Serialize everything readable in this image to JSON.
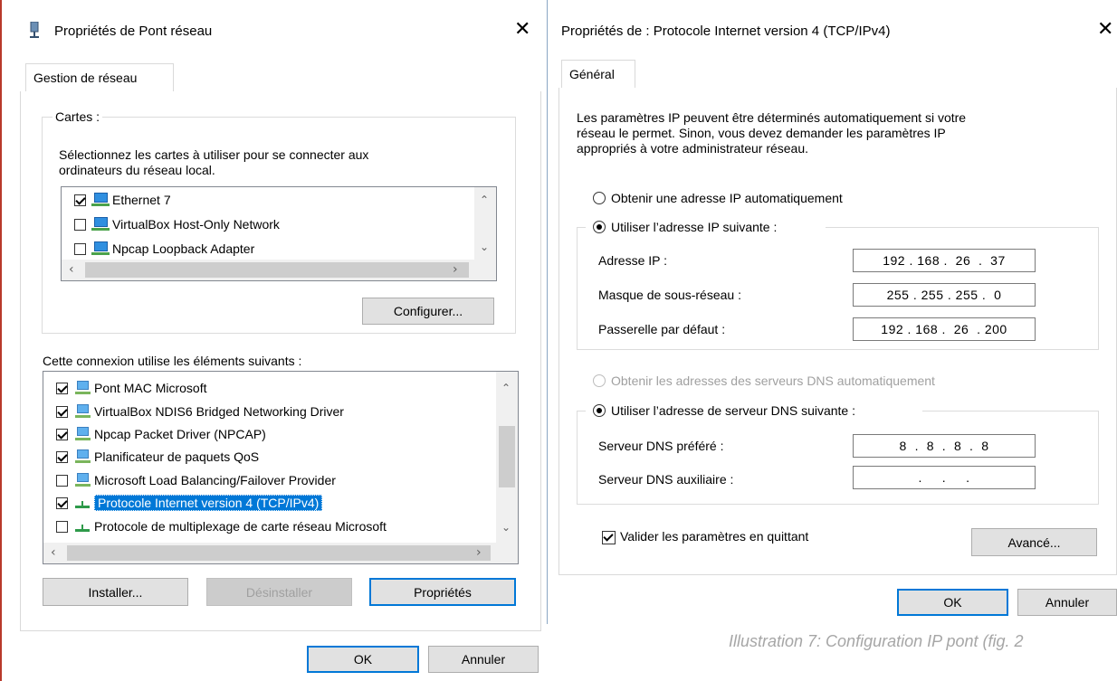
{
  "bridge": {
    "title": "Propriétés de Pont réseau",
    "tab": "Gestion de réseau",
    "cartes_label": "Cartes :",
    "cartes_desc": [
      "Sélectionnez les cartes à utiliser pour se connecter aux",
      "ordinateurs du réseau local."
    ],
    "adapters": [
      {
        "label": "Ethernet 7",
        "checked": true
      },
      {
        "label": "VirtualBox Host-Only Network",
        "checked": false
      },
      {
        "label": "Npcap Loopback Adapter",
        "checked": false
      }
    ],
    "configure_button": "Configurer...",
    "elements_label": "Cette connexion utilise les éléments suivants :",
    "components": [
      {
        "label": "Pont MAC Microsoft",
        "checked": true,
        "icon": "network-component-icon"
      },
      {
        "label": "VirtualBox NDIS6 Bridged Networking Driver",
        "checked": true,
        "icon": "network-component-icon"
      },
      {
        "label": "Npcap Packet Driver (NPCAP)",
        "checked": true,
        "icon": "network-component-icon"
      },
      {
        "label": "Planificateur de paquets QoS",
        "checked": true,
        "icon": "network-component-icon"
      },
      {
        "label": "Microsoft Load Balancing/Failover Provider",
        "checked": false,
        "icon": "network-component-icon"
      },
      {
        "label": "Protocole Internet version 4 (TCP/IPv4)",
        "checked": true,
        "icon": "protocol-icon",
        "selected": true
      },
      {
        "label": "Protocole de multiplexage de carte réseau Microsoft",
        "checked": false,
        "icon": "protocol-icon"
      }
    ],
    "install_button": "Installer...",
    "uninstall_button": "Désinstaller",
    "properties_button": "Propriétés",
    "ok_button": "OK",
    "cancel_button": "Annuler"
  },
  "ipv4": {
    "title": "Propriétés de : Protocole Internet version 4 (TCP/IPv4)",
    "tab": "Général",
    "intro": [
      "Les paramètres IP peuvent être déterminés automatiquement si votre",
      "réseau le permet. Sinon, vous devez demander les paramètres IP",
      "appropriés à votre administrateur réseau."
    ],
    "auto_ip": "Obtenir une adresse IP automatiquement",
    "manual_ip": "Utiliser l’adresse IP suivante :",
    "ip_label": "Adresse IP :",
    "ip_value": "192 . 168 .  26  .  37",
    "mask_label": "Masque de sous-réseau :",
    "mask_value": "255 . 255 . 255 .  0",
    "gateway_label": "Passerelle par défaut :",
    "gateway_value": "192 . 168 .  26  . 200",
    "auto_dns": "Obtenir les adresses des serveurs DNS automatiquement",
    "manual_dns": "Utiliser l’adresse de serveur DNS suivante :",
    "dns_pref_label": "Serveur DNS préféré :",
    "dns_pref_value": "8  .  8  .  8  .  8",
    "dns_alt_label": "Serveur DNS auxiliaire :",
    "dns_alt_value": ".     .     .",
    "validate_label": "Valider les paramètres en quittant",
    "advanced_button": "Avancé...",
    "ok_button": "OK",
    "cancel_button": "Annuler"
  },
  "caption": "Illustration 7: Configuration IP pont (fig. 2"
}
